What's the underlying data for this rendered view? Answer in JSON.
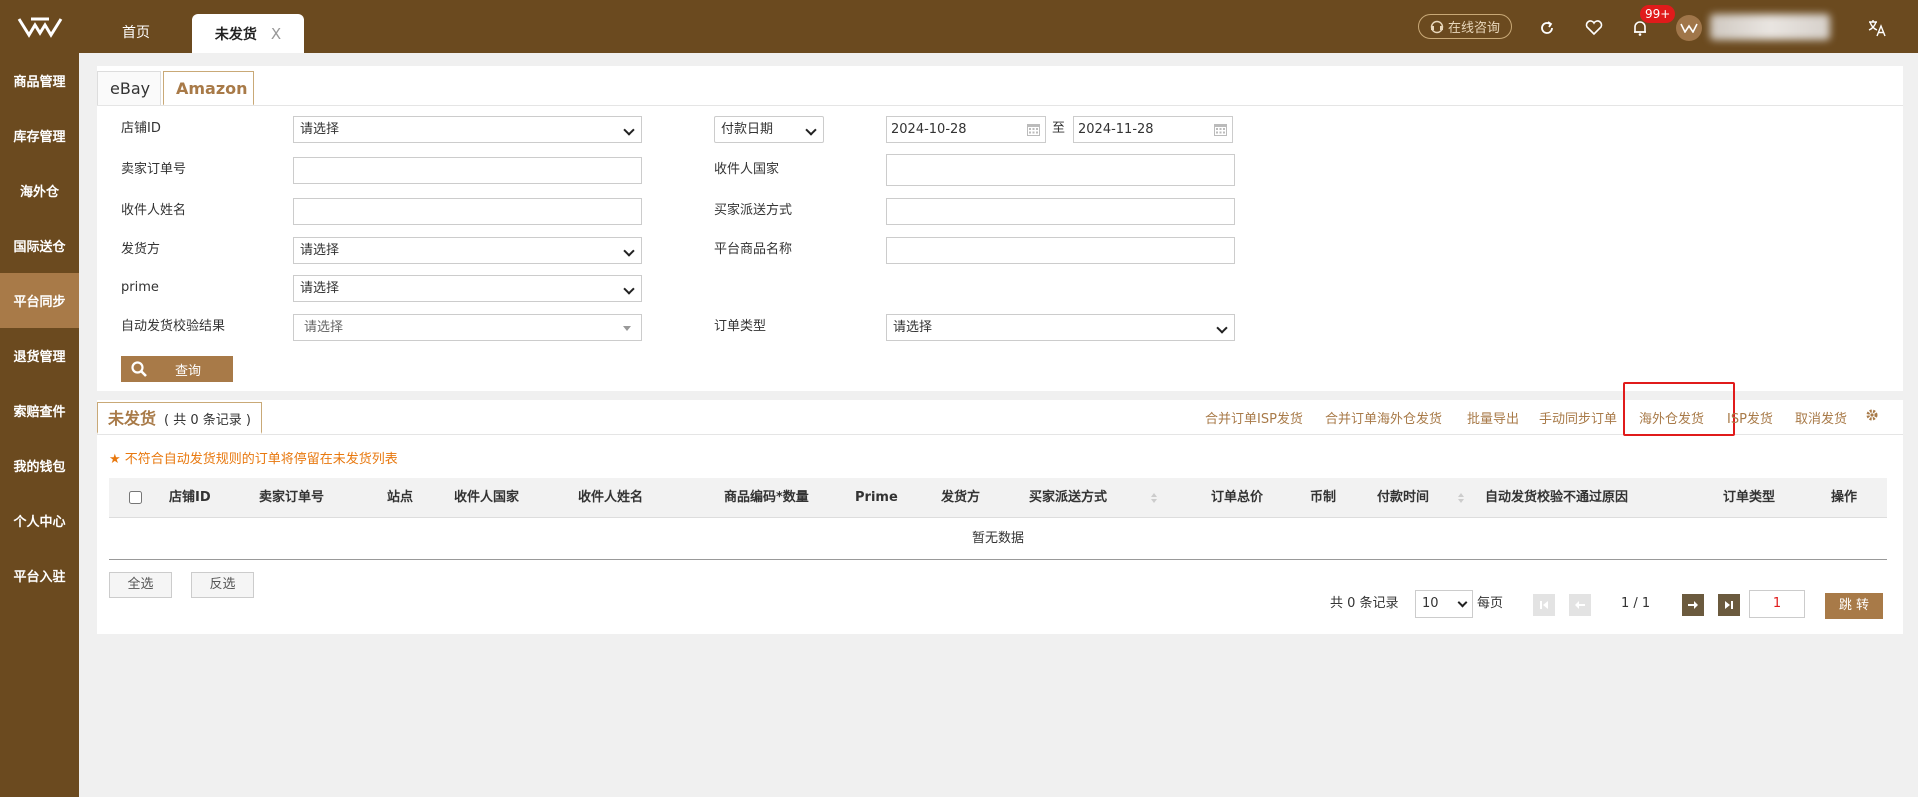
{
  "header": {
    "home_tab": "首页",
    "active_tab": "未发货",
    "close_glyph": "X",
    "consult_label": "在线咨询",
    "notification_badge": "99+"
  },
  "sidebar": {
    "items": [
      {
        "label": "商品管理",
        "active": false
      },
      {
        "label": "库存管理",
        "active": false
      },
      {
        "label": "海外仓",
        "active": false
      },
      {
        "label": "国际送仓",
        "active": false
      },
      {
        "label": "平台同步",
        "active": true
      },
      {
        "label": "退货管理",
        "active": false
      },
      {
        "label": "索赔查件",
        "active": false
      },
      {
        "label": "我的钱包",
        "active": false
      },
      {
        "label": "个人中心",
        "active": false
      },
      {
        "label": "平台入驻",
        "active": false
      }
    ]
  },
  "platform_tabs": {
    "ebay": "eBay",
    "amazon": "Amazon",
    "active": "Amazon"
  },
  "filters": {
    "shop_id": {
      "label": "店铺ID",
      "value": "请选择"
    },
    "seller_order_no": {
      "label": "卖家订单号",
      "value": ""
    },
    "recipient_name": {
      "label": "收件人姓名",
      "value": ""
    },
    "shipper": {
      "label": "发货方",
      "value": "请选择"
    },
    "prime": {
      "label": "prime",
      "value": "请选择"
    },
    "auto_check_result": {
      "label": "自动发货校验结果",
      "value": "请选择"
    },
    "date_type": {
      "value": "付款日期"
    },
    "date_from": "2024-10-28",
    "date_sep": "至",
    "date_to": "2024-11-28",
    "recipient_country": {
      "label": "收件人国家",
      "value": ""
    },
    "buyer_shipping": {
      "label": "买家派送方式",
      "value": ""
    },
    "platform_product_name": {
      "label": "平台商品名称",
      "value": ""
    },
    "order_type": {
      "label": "订单类型",
      "value": "请选择"
    },
    "query_button": "查询"
  },
  "list": {
    "title": "未发货",
    "count_text": "( 共 0 条记录 )",
    "actions": [
      "合并订单ISP发货",
      "合并订单海外仓发货",
      "批量导出",
      "手动同步订单",
      "海外仓发货",
      "ISP发货",
      "取消发货"
    ],
    "highlighted_action": "手动同步订单",
    "notice": "不符合自动发货规则的订单将停留在未发货列表",
    "columns": [
      "店铺ID",
      "卖家订单号",
      "站点",
      "收件人国家",
      "收件人姓名",
      "商品编码*数量",
      "Prime",
      "发货方",
      "买家派送方式",
      "订单总价",
      "币制",
      "付款时间",
      "自动发货校验不通过原因",
      "订单类型",
      "操作"
    ],
    "empty_text": "暂无数据",
    "select_all": "全选",
    "invert_select": "反选"
  },
  "pagination": {
    "total_text": "共 0 条记录",
    "page_size": "10",
    "per_page_label": "每页",
    "page_indicator": "1 / 1",
    "page_input": "1",
    "jump_label": "跳 转"
  },
  "colors": {
    "brand_dark": "#6b4a1f",
    "accent": "#a87a48",
    "highlight": "#e01b1b",
    "notice": "#e8780e"
  }
}
